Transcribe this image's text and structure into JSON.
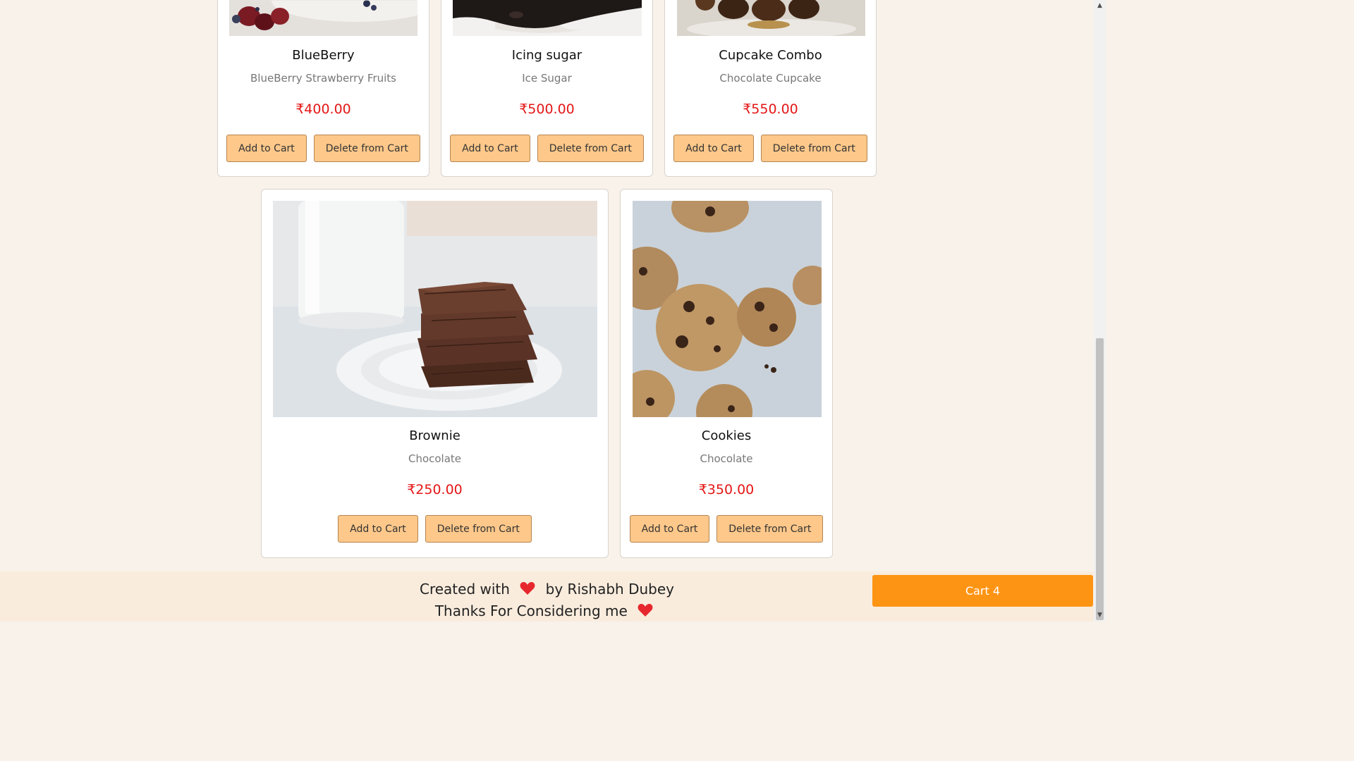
{
  "products": [
    {
      "name": "BlueBerry",
      "description": "BlueBerry Strawberry Fruits",
      "price": "₹400.00",
      "add_label": "Add to Cart",
      "delete_label": "Delete from Cart"
    },
    {
      "name": "Icing sugar",
      "description": "Ice Sugar",
      "price": "₹500.00",
      "add_label": "Add to Cart",
      "delete_label": "Delete from Cart"
    },
    {
      "name": "Cupcake Combo",
      "description": "Chocolate Cupcake",
      "price": "₹550.00",
      "add_label": "Add to Cart",
      "delete_label": "Delete from Cart"
    },
    {
      "name": "Brownie",
      "description": "Chocolate",
      "price": "₹250.00",
      "add_label": "Add to Cart",
      "delete_label": "Delete from Cart"
    },
    {
      "name": "Cookies",
      "description": "Chocolate",
      "price": "₹350.00",
      "add_label": "Add to Cart",
      "delete_label": "Delete from Cart"
    }
  ],
  "footer": {
    "created_prefix": "Created with",
    "created_suffix": "by Rishabh Dubey",
    "thanks": "Thanks For Considering me",
    "heart_icon": "heart-icon"
  },
  "cart": {
    "label": "Cart 4"
  },
  "colors": {
    "page_background": "#f8f2ea",
    "price": "#e41616",
    "button": "#fdc88a",
    "cart_button": "#fe9414",
    "footer_background": "#f9ecdd"
  }
}
